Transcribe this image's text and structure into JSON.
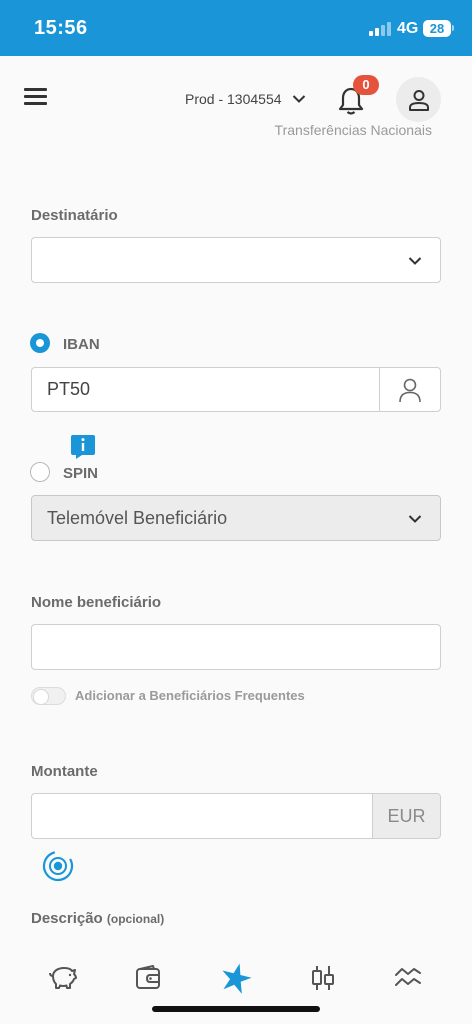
{
  "status_bar": {
    "time": "15:56",
    "network": "4G",
    "battery": "28"
  },
  "header": {
    "account": "Prod - 1304554",
    "notifications_count": "0",
    "page_title": "Transferências Nacionais"
  },
  "form": {
    "destinatario_label": "Destinatário",
    "destinatario_value": "",
    "iban_label": "IBAN",
    "iban_value": "PT50",
    "iban_selected": true,
    "spin_label": "SPIN",
    "spin_selected": false,
    "spin_select_value": "Telemóvel Beneficiário",
    "nome_label": "Nome beneficiário",
    "nome_value": "",
    "favorites_toggle_label": "Adicionar a Beneficiários Frequentes",
    "favorites_toggle_on": false,
    "montante_label": "Montante",
    "montante_value": "",
    "currency": "EUR",
    "descricao_label": "Descrição",
    "descricao_hint": "(opcional)"
  },
  "bottom_nav": [
    {
      "name": "piggy-bank-icon"
    },
    {
      "name": "wallet-icon"
    },
    {
      "name": "star-logo-icon",
      "active": true
    },
    {
      "name": "candlestick-chart-icon"
    },
    {
      "name": "trend-lines-icon"
    }
  ],
  "colors": {
    "accent": "#1995d8",
    "badge": "#e5533d"
  }
}
